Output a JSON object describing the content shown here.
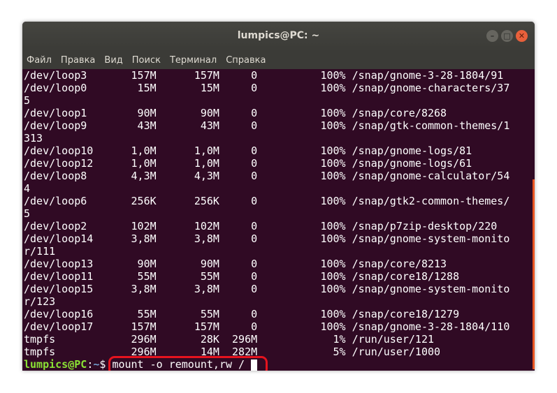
{
  "window": {
    "title": "lumpics@PC: ~"
  },
  "menu": [
    "Файл",
    "Правка",
    "Вид",
    "Поиск",
    "Терминал",
    "Справка"
  ],
  "terminal": {
    "lines": [
      "/dev/loop3       157M      157M     0          100% /snap/gnome-3-28-1804/91",
      "/dev/loop0        15M       15M     0          100% /snap/gnome-characters/37",
      "5",
      "/dev/loop1        90M       90M     0          100% /snap/core/8268",
      "/dev/loop9        43M       43M     0          100% /snap/gtk-common-themes/1",
      "313",
      "/dev/loop10      1,0M      1,0M     0          100% /snap/gnome-logs/81",
      "/dev/loop12      1,0M      1,0M     0          100% /snap/gnome-logs/61",
      "/dev/loop8       4,3M      4,3M     0          100% /snap/gnome-calculator/54",
      "4",
      "/dev/loop6       256K      256K     0          100% /snap/gtk2-common-themes/",
      "5",
      "/dev/loop2       102M      102M     0          100% /snap/p7zip-desktop/220",
      "/dev/loop14      3,8M      3,8M     0          100% /snap/gnome-system-monito",
      "r/111",
      "/dev/loop13       90M       90M     0          100% /snap/core/8213",
      "/dev/loop11       55M       55M     0          100% /snap/core18/1288",
      "/dev/loop15      3,8M      3,8M     0          100% /snap/gnome-system-monito",
      "r/123",
      "/dev/loop16       55M       55M     0          100% /snap/core18/1279",
      "/dev/loop17      157M      157M     0          100% /snap/gnome-3-28-1804/110",
      "tmpfs            296M       28K  296M            1% /run/user/121",
      "tmpfs            296M       14M  282M            5% /run/user/1000"
    ],
    "prompt_user": "lumpics@PC",
    "prompt_sep": ":",
    "prompt_path": "~",
    "prompt_symbol": "$ ",
    "command": "mount -o remount,rw /"
  },
  "colors": {
    "terminal_bg": "#300a24",
    "prompt_user": "#8ae234",
    "prompt_path": "#729fcf",
    "highlight": "#e5131e",
    "scrollbar": "#e95420"
  }
}
